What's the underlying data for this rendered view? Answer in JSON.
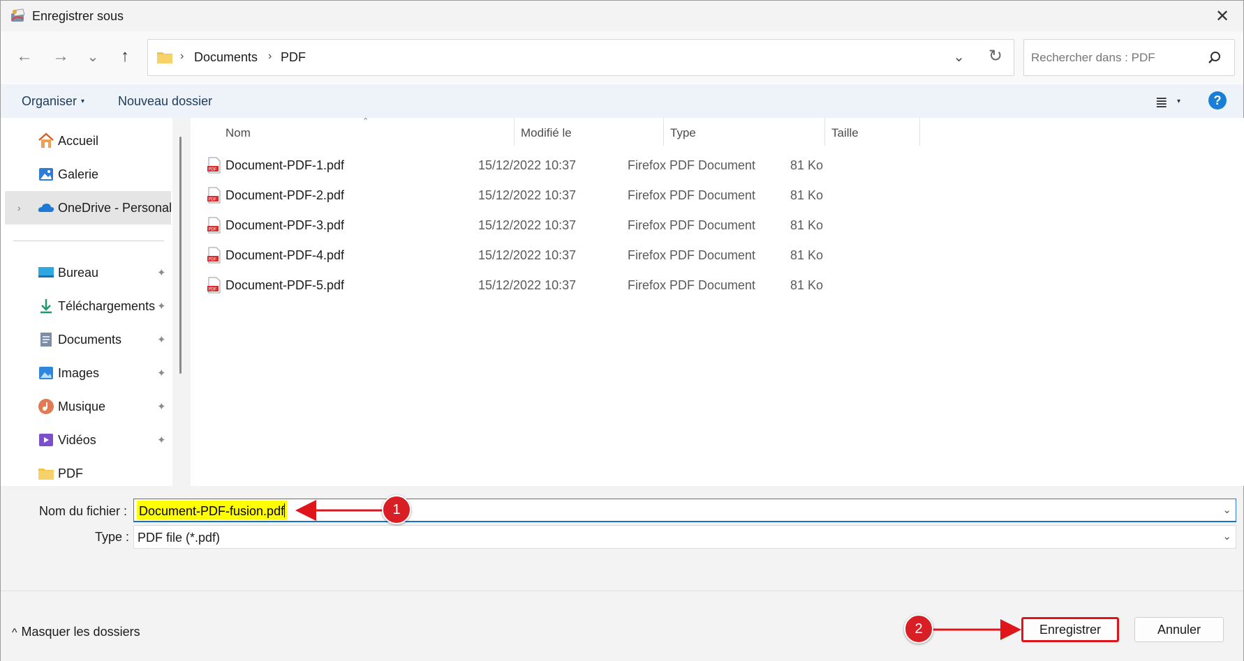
{
  "window": {
    "title": "Enregistrer sous",
    "close_glyph": "✕"
  },
  "nav": {
    "back_glyph": "←",
    "forward_glyph": "→",
    "recent_glyph": "⌄",
    "up_glyph": "↑",
    "breadcrumb": [
      "Documents",
      "PDF"
    ],
    "separator": "›",
    "dropdown_glyph": "⌄",
    "refresh_glyph": "↻"
  },
  "search": {
    "placeholder": "Rechercher dans : PDF"
  },
  "toolbar": {
    "organize_label": "Organiser",
    "organize_caret": "▾",
    "new_folder_label": "Nouveau dossier",
    "view_glyph": "≣",
    "view_caret": "▾",
    "help_glyph": "?"
  },
  "sidebar": {
    "items": [
      {
        "label": "Accueil",
        "icon": "home-icon",
        "pinned": false
      },
      {
        "label": "Galerie",
        "icon": "gallery-icon",
        "pinned": false
      },
      {
        "label": "OneDrive - Personal",
        "icon": "onedrive-icon",
        "pinned": false,
        "selected": true,
        "expander": "›"
      },
      {
        "label": "Bureau",
        "icon": "desktop-icon",
        "pinned": true
      },
      {
        "label": "Téléchargements",
        "icon": "download-icon",
        "pinned": true
      },
      {
        "label": "Documents",
        "icon": "documents-icon",
        "pinned": true
      },
      {
        "label": "Images",
        "icon": "images-icon",
        "pinned": true
      },
      {
        "label": "Musique",
        "icon": "music-icon",
        "pinned": true
      },
      {
        "label": "Vidéos",
        "icon": "videos-icon",
        "pinned": true
      },
      {
        "label": "PDF",
        "icon": "folder-icon",
        "pinned": false
      }
    ],
    "pin_glyph": "📌"
  },
  "filelist": {
    "columns": {
      "name": "Nom",
      "modified": "Modifié le",
      "type": "Type",
      "size": "Taille"
    },
    "sort_glyph": "⌃",
    "files": [
      {
        "name": "Document-PDF-1.pdf",
        "modified": "15/12/2022 10:37",
        "type": "Firefox PDF Document",
        "size": "81 Ko"
      },
      {
        "name": "Document-PDF-2.pdf",
        "modified": "15/12/2022 10:37",
        "type": "Firefox PDF Document",
        "size": "81 Ko"
      },
      {
        "name": "Document-PDF-3.pdf",
        "modified": "15/12/2022 10:37",
        "type": "Firefox PDF Document",
        "size": "81 Ko"
      },
      {
        "name": "Document-PDF-4.pdf",
        "modified": "15/12/2022 10:37",
        "type": "Firefox PDF Document",
        "size": "81 Ko"
      },
      {
        "name": "Document-PDF-5.pdf",
        "modified": "15/12/2022 10:37",
        "type": "Firefox PDF Document",
        "size": "81 Ko"
      }
    ]
  },
  "form": {
    "filename_label": "Nom du fichier :",
    "filename_value": "Document-PDF-fusion.pdf",
    "type_label": "Type :",
    "type_value": "PDF file (*.pdf)",
    "chevron": "⌄"
  },
  "footer": {
    "hide_folders_label": "Masquer les dossiers",
    "hide_caret": "^",
    "save_label": "Enregistrer",
    "cancel_label": "Annuler"
  },
  "annotations": {
    "badge1": "1",
    "badge2": "2",
    "color": "#d81f26"
  },
  "colors": {
    "accent": "#1a7fd4",
    "highlight": "#ffff00",
    "annotation": "#e0141b"
  }
}
